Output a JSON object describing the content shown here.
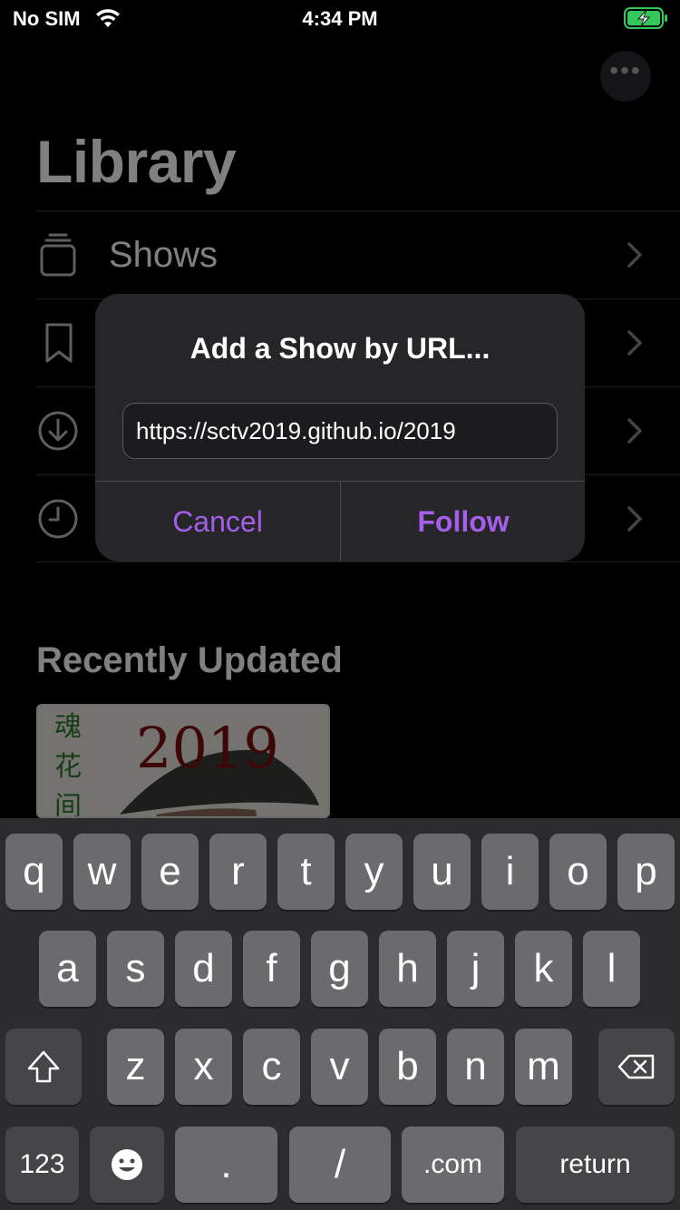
{
  "status_bar": {
    "carrier": "No SIM",
    "time": "4:34 PM",
    "battery_color": "#34c759"
  },
  "background": {
    "title": "Library",
    "rows": [
      {
        "label": "Shows",
        "icon": "shows-stack-icon"
      },
      {
        "label": "",
        "icon": "bookmark-icon"
      },
      {
        "label": "",
        "icon": "download-icon"
      },
      {
        "label": "",
        "icon": "history-clock-icon"
      }
    ],
    "recent_title": "Recently Updated",
    "thumbnail": {
      "year": "2019",
      "chars": [
        "魂",
        "花",
        "间"
      ]
    }
  },
  "alert": {
    "title": "Add a Show by URL...",
    "input_value": "https://sctv2019.github.io/2019",
    "cancel_label": "Cancel",
    "follow_label": "Follow",
    "accent_color": "#a55eea"
  },
  "keyboard": {
    "row1": [
      "q",
      "w",
      "e",
      "r",
      "t",
      "y",
      "u",
      "i",
      "o",
      "p"
    ],
    "row2": [
      "a",
      "s",
      "d",
      "f",
      "g",
      "h",
      "j",
      "k",
      "l"
    ],
    "row3": [
      "z",
      "x",
      "c",
      "v",
      "b",
      "n",
      "m"
    ],
    "numbers_label": "123",
    "dot_label": ".",
    "slash_label": "/",
    "dotcom_label": ".com",
    "return_label": "return"
  }
}
